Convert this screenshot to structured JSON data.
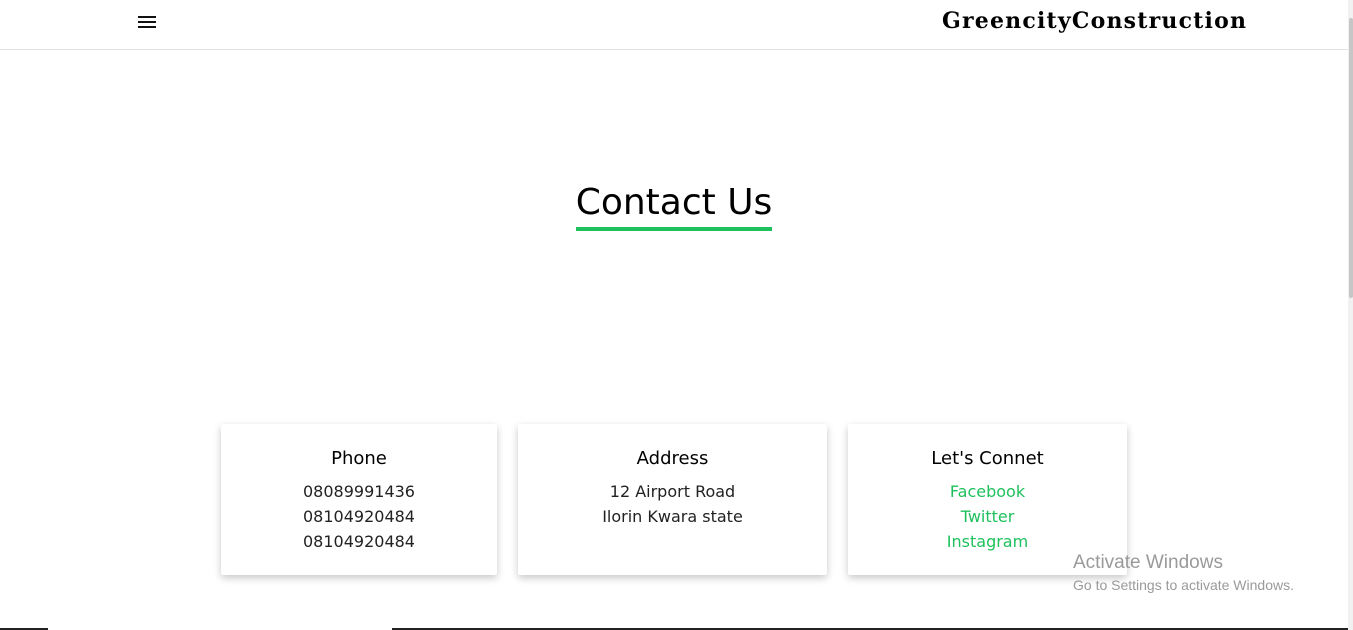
{
  "header": {
    "menu_icon": "hamburger-menu-icon",
    "brand": "GreencityConstruction"
  },
  "main": {
    "title": "Contact Us",
    "accent_color": "#1ec15d"
  },
  "cards": {
    "phone": {
      "heading": "Phone",
      "lines": [
        "08089991436",
        "08104920484",
        "08104920484"
      ]
    },
    "address": {
      "heading": "Address",
      "lines": [
        "12 Airport Road",
        "Ilorin Kwara state"
      ]
    },
    "connect": {
      "heading": "Let's Connet",
      "links": [
        "Facebook",
        "Twitter",
        "Instagram"
      ]
    }
  },
  "watermark": {
    "title": "Activate Windows",
    "subtitle": "Go to Settings to activate Windows."
  }
}
